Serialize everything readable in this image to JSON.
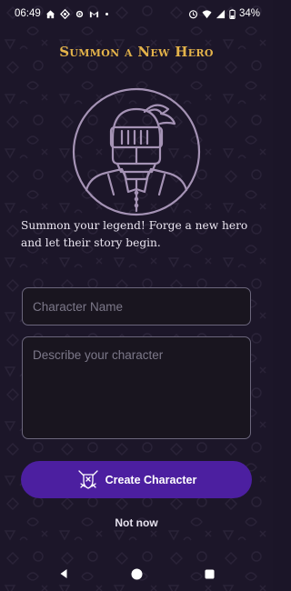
{
  "status_bar": {
    "time": "06:49",
    "battery": "34%",
    "left_icons": [
      "home-icon",
      "location-icon",
      "settings-icon",
      "gmail-icon"
    ],
    "right_icons": [
      "alarm-icon",
      "wifi-icon",
      "signal-icon",
      "battery-icon"
    ]
  },
  "header": {
    "title": "Summon a New Hero"
  },
  "avatar": {
    "icon": "knight-helmet-icon"
  },
  "intro": {
    "text": "Summon your legend! Forge a new hero and let their story begin."
  },
  "form": {
    "name_placeholder": "Character Name",
    "name_value": "",
    "description_placeholder": "Describe your character",
    "description_value": ""
  },
  "actions": {
    "create_label": "Create Character",
    "create_icon": "crossed-swords-shield-icon",
    "not_now_label": "Not now"
  },
  "nav_bar": {
    "icons": [
      "back-icon",
      "home-icon",
      "recents-icon"
    ]
  },
  "colors": {
    "background": "#1c1629",
    "title_gold": "#e4b34a",
    "button_purple": "#4c1fa0",
    "field_border": "#6b667c"
  }
}
